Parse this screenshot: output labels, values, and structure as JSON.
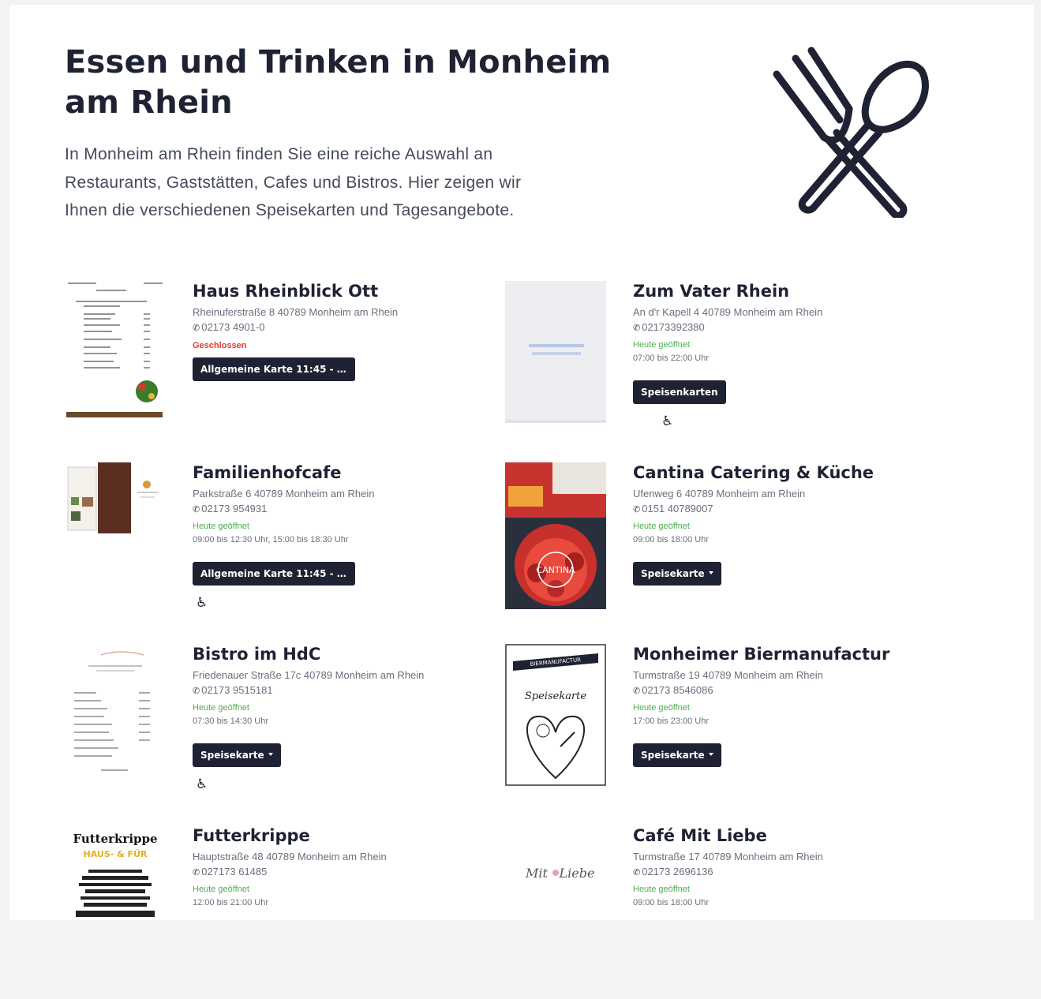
{
  "hero": {
    "title_line1": "Essen und Trinken in Monheim",
    "title_line2": "am Rhein",
    "text_line1": "In Monheim am Rhein finden Sie eine reiche Auswahl an",
    "text_line2": "Restaurants, Gaststätten, Cafes und Bistros. Hier zeigen wir",
    "text_line3": "Ihnen die verschiedenen Speisekarten und Tagesangebote.",
    "icon": "fork-spoon-icon"
  },
  "restaurants": [
    {
      "name": "Haus Rheinblick Ott",
      "address": "Rheinuferstraße 8 40789 Monheim am Rhein",
      "phone": "02173 4901-0",
      "status": "Geschlossen",
      "button": "Allgemeine Karte 11:45 - 14..."
    },
    {
      "name": "Zum Vater Rhein",
      "address": "An d'r Kapell 4 40789 Monheim am Rhein",
      "phone": "02173392380",
      "status": "Heute geöffnet",
      "hours": "07:00 bis 22:00 Uhr",
      "button": "Speisenkarten",
      "accessibility_icon": "wheelchair-icon"
    },
    {
      "name": "Familienhofcafe",
      "address": "Parkstraße 6 40789 Monheim am Rhein",
      "phone": "02173 954931",
      "status": "Heute geöffnet",
      "hours": "09:00 bis 12:30 Uhr, 15:00 bis 18:30 Uhr",
      "button": "Allgemeine Karte 11:45 - 14...",
      "accessibility_icon": "wheelchair-icon"
    },
    {
      "name": "Cantina Catering & Küche",
      "address": "Ufenweg 6 40789 Monheim am Rhein",
      "phone": "0151 40789007",
      "status": "Heute geöffnet",
      "hours": "09:00 bis 18:00 Uhr",
      "button": "Speisekarte",
      "thumb_text": "CANTINA"
    },
    {
      "name": "Bistro im HdC",
      "address": "Friedenauer Straße 17c 40789 Monheim am Rhein",
      "phone": "02173 9515181",
      "status": "Heute geöffnet",
      "hours": "07:30 bis 14:30 Uhr",
      "button": "Speisekarte",
      "accessibility_icon": "wheelchair-icon"
    },
    {
      "name": "Monheimer Biermanufactur",
      "address": "Turmstraße 19 40789 Monheim am Rhein",
      "phone": "02173 8546086",
      "status": "Heute geöffnet",
      "hours": "17:00 bis 23:00 Uhr",
      "button": "Speisekarte",
      "thumb_banner": "BIERMANUFACTUR",
      "thumb_text": "Speisekarte"
    },
    {
      "name": "Futterkrippe",
      "address": "Hauptstraße 48 40789 Monheim am Rhein",
      "phone": "027173 61485",
      "status": "Heute geöffnet",
      "hours": "12:00 bis 21:00 Uhr",
      "thumb_title": "Futterkrippe",
      "thumb_sub": "HAUS- & FÜR"
    },
    {
      "name": "Café Mit Liebe",
      "address": "Turmstraße 17 40789 Monheim am Rhein",
      "phone": "02173 2696136",
      "status": "Heute geöffnet",
      "hours": "09:00 bis 18:00 Uhr",
      "thumb_text_a": "Mit",
      "thumb_text_b": "Liebe"
    }
  ],
  "colors": {
    "primary": "#1e2233",
    "open": "#4caf50",
    "closed": "#e53935"
  }
}
